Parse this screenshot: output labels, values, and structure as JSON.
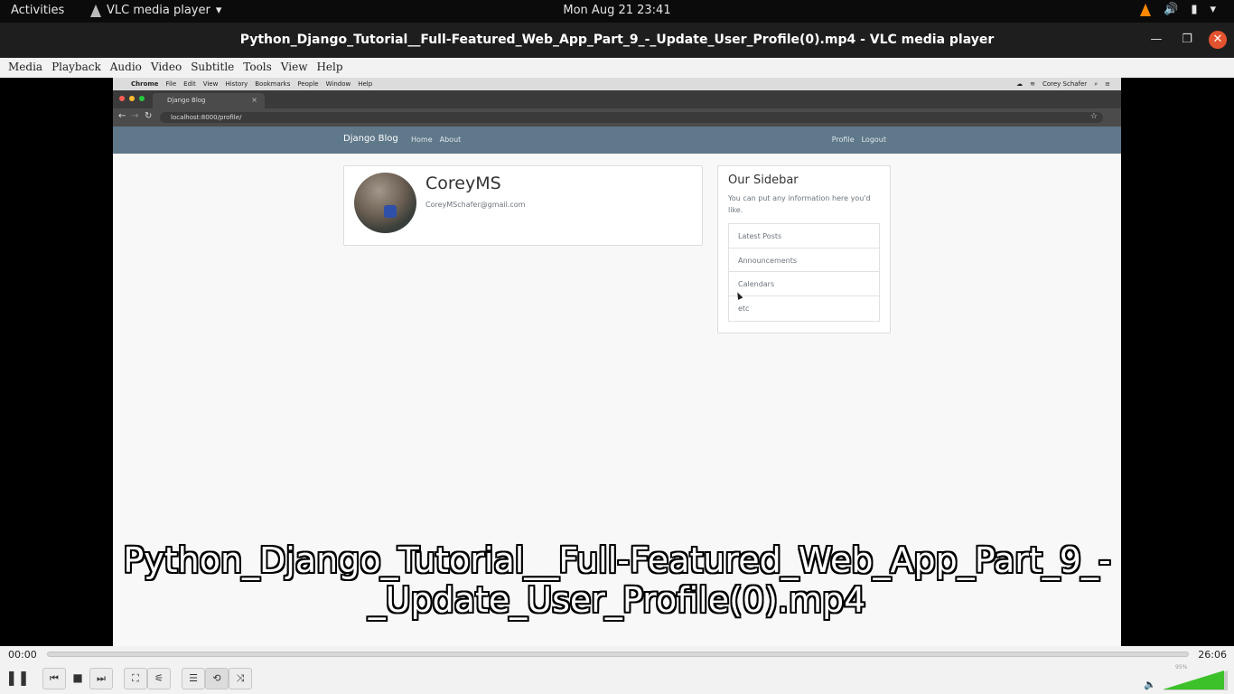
{
  "topbar": {
    "activities": "Activities",
    "app_name": "VLC media player",
    "clock": "Mon Aug 21  23:41"
  },
  "window": {
    "title": "Python_Django_Tutorial__Full-Featured_Web_App_Part_9_-_Update_User_Profile(0).mp4 - VLC media player"
  },
  "menu": {
    "items": [
      "Media",
      "Playback",
      "Audio",
      "Video",
      "Subtitle",
      "Tools",
      "View",
      "Help"
    ]
  },
  "mac_menu": {
    "items": [
      "Chrome",
      "File",
      "Edit",
      "View",
      "History",
      "Bookmarks",
      "People",
      "Window",
      "Help"
    ],
    "user": "Corey Schafer"
  },
  "browser": {
    "tab_title": "Django Blog",
    "url": "localhost:8000/profile/"
  },
  "site": {
    "brand": "Django Blog",
    "nav_left": [
      "Home",
      "About"
    ],
    "nav_right": [
      "Profile",
      "Logout"
    ]
  },
  "profile": {
    "username": "CoreyMS",
    "email": "CoreyMSchafer@gmail.com"
  },
  "sidebar": {
    "heading": "Our Sidebar",
    "description": "You can put any information here you'd like.",
    "items": [
      "Latest Posts",
      "Announcements",
      "Calendars",
      "etc"
    ]
  },
  "subtitle": {
    "text": "Python_Django_Tutorial__Full-Featured_Web_App_Part_9_-_Update_User_Profile(0).mp4"
  },
  "player": {
    "elapsed": "00:00",
    "duration": "26:06",
    "progress": 0,
    "volume_label": "95%",
    "volume": 0.95
  },
  "colors": {
    "django_nav": "#5f788a",
    "vlc_accent": "#ff8800",
    "close_button": "#e35330",
    "volume_fill": "#3cc12a"
  }
}
